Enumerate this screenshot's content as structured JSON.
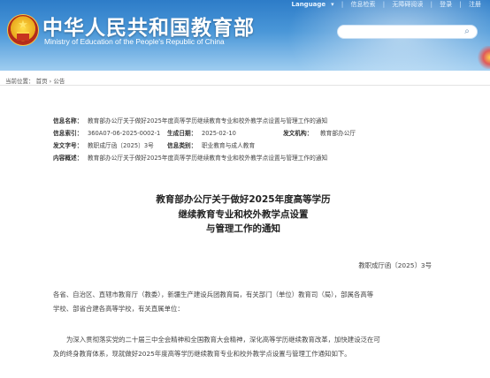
{
  "header": {
    "site_title": "中华人民共和国教育部",
    "site_subtitle": "Ministry of Education of the People's Republic of China",
    "top_nav": [
      "Language",
      "信息检索",
      "无障碍阅读",
      "登录",
      "注册"
    ],
    "search_placeholder": "",
    "accent_color": "#2d7cc8"
  },
  "breadcrumb": {
    "prefix": "当前位置：",
    "items": [
      "首页",
      "公告"
    ],
    "separator": "›"
  },
  "info": {
    "name_label": "信息名称：",
    "name_value": "教育部办公厅关于做好2025年度高等学历继续教育专业和校外教学点设置与管理工作的通知",
    "index_label": "信息索引：",
    "index_value": "360A07-06-2025-0002-1",
    "date_label": "生成日期：",
    "date_value": "2025-02-10",
    "issuer_label": "发文机构：",
    "issuer_value": "教育部办公厅",
    "docno_label": "发文字号：",
    "docno_value": "教职成厅函〔2025〕3号",
    "category_label": "信息类别：",
    "category_value": "职业教育与成人教育",
    "summary_label": "内容概述：",
    "summary_value": "教育部办公厅关于做好2025年度高等学历继续教育专业和校外教学点设置与管理工作的通知"
  },
  "article": {
    "title_lines": [
      "教育部办公厅关于做好2025年度高等学历",
      "继续教育专业和校外教学点设置",
      "与管理工作的通知"
    ],
    "doc_number": "教职成厅函〔2025〕3号",
    "para1_lines": [
      "各省、自治区、直辖市教育厅（教委），新疆生产建设兵团教育局，有关部门（单位）教育司（局），部属各高等",
      "学校、部省合建各高等学校，有关直属单位："
    ],
    "para2_lines": [
      "为深入贯彻落实党的二十届三中全会精神和全国教育大会精神，深化高等学历继续教育改革，加快建设泛在可",
      "及的终身教育体系，现就做好2025年度高等学历继续教育专业和校外教学点设置与管理工作通知如下。"
    ]
  }
}
